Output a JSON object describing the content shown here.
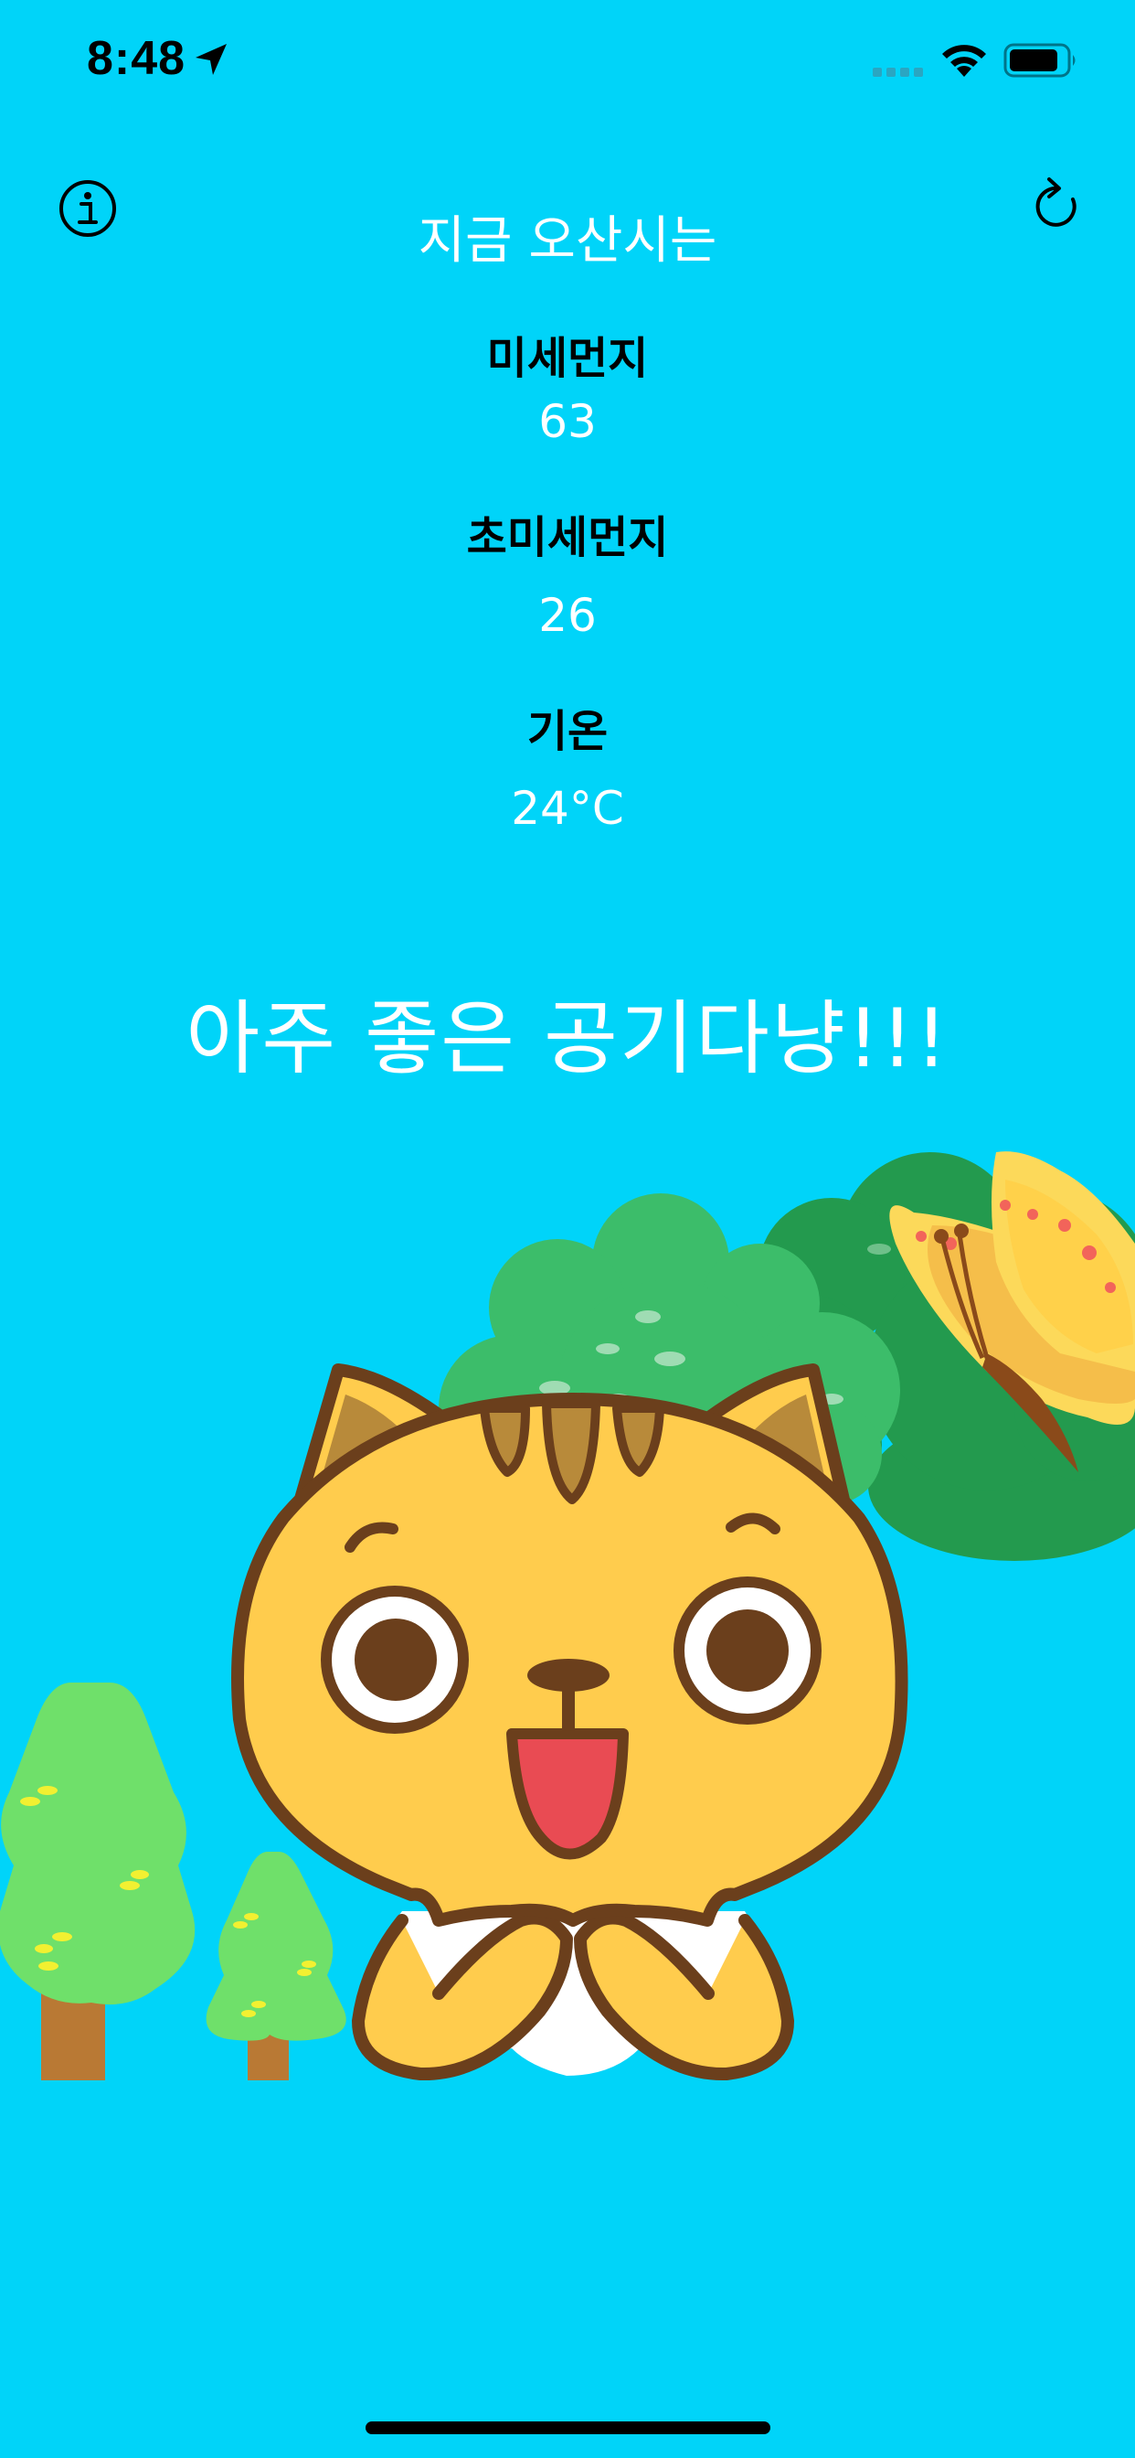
{
  "status_bar": {
    "time": "8:48",
    "icons": [
      "location-arrow-icon",
      "cellular-signal-icon",
      "wifi-icon",
      "battery-icon"
    ]
  },
  "header": {
    "title": "지금 오산시는",
    "info_icon": "info-icon",
    "refresh_icon": "refresh-icon"
  },
  "readings": {
    "pm10": {
      "label": "미세먼지",
      "value": "63"
    },
    "pm25": {
      "label": "초미세먼지",
      "value": "26"
    },
    "temperature": {
      "label": "기온",
      "value": "24°C"
    }
  },
  "status_message": "아주 좋은 공기다냥!!!",
  "colors": {
    "background": "#00D4F9",
    "cat_body": "#FFCC4D",
    "cat_outline": "#6B3F1C",
    "tree_green": "#6FE06A",
    "bush_dark": "#239A4E",
    "bush_light": "#3CBD6A"
  }
}
